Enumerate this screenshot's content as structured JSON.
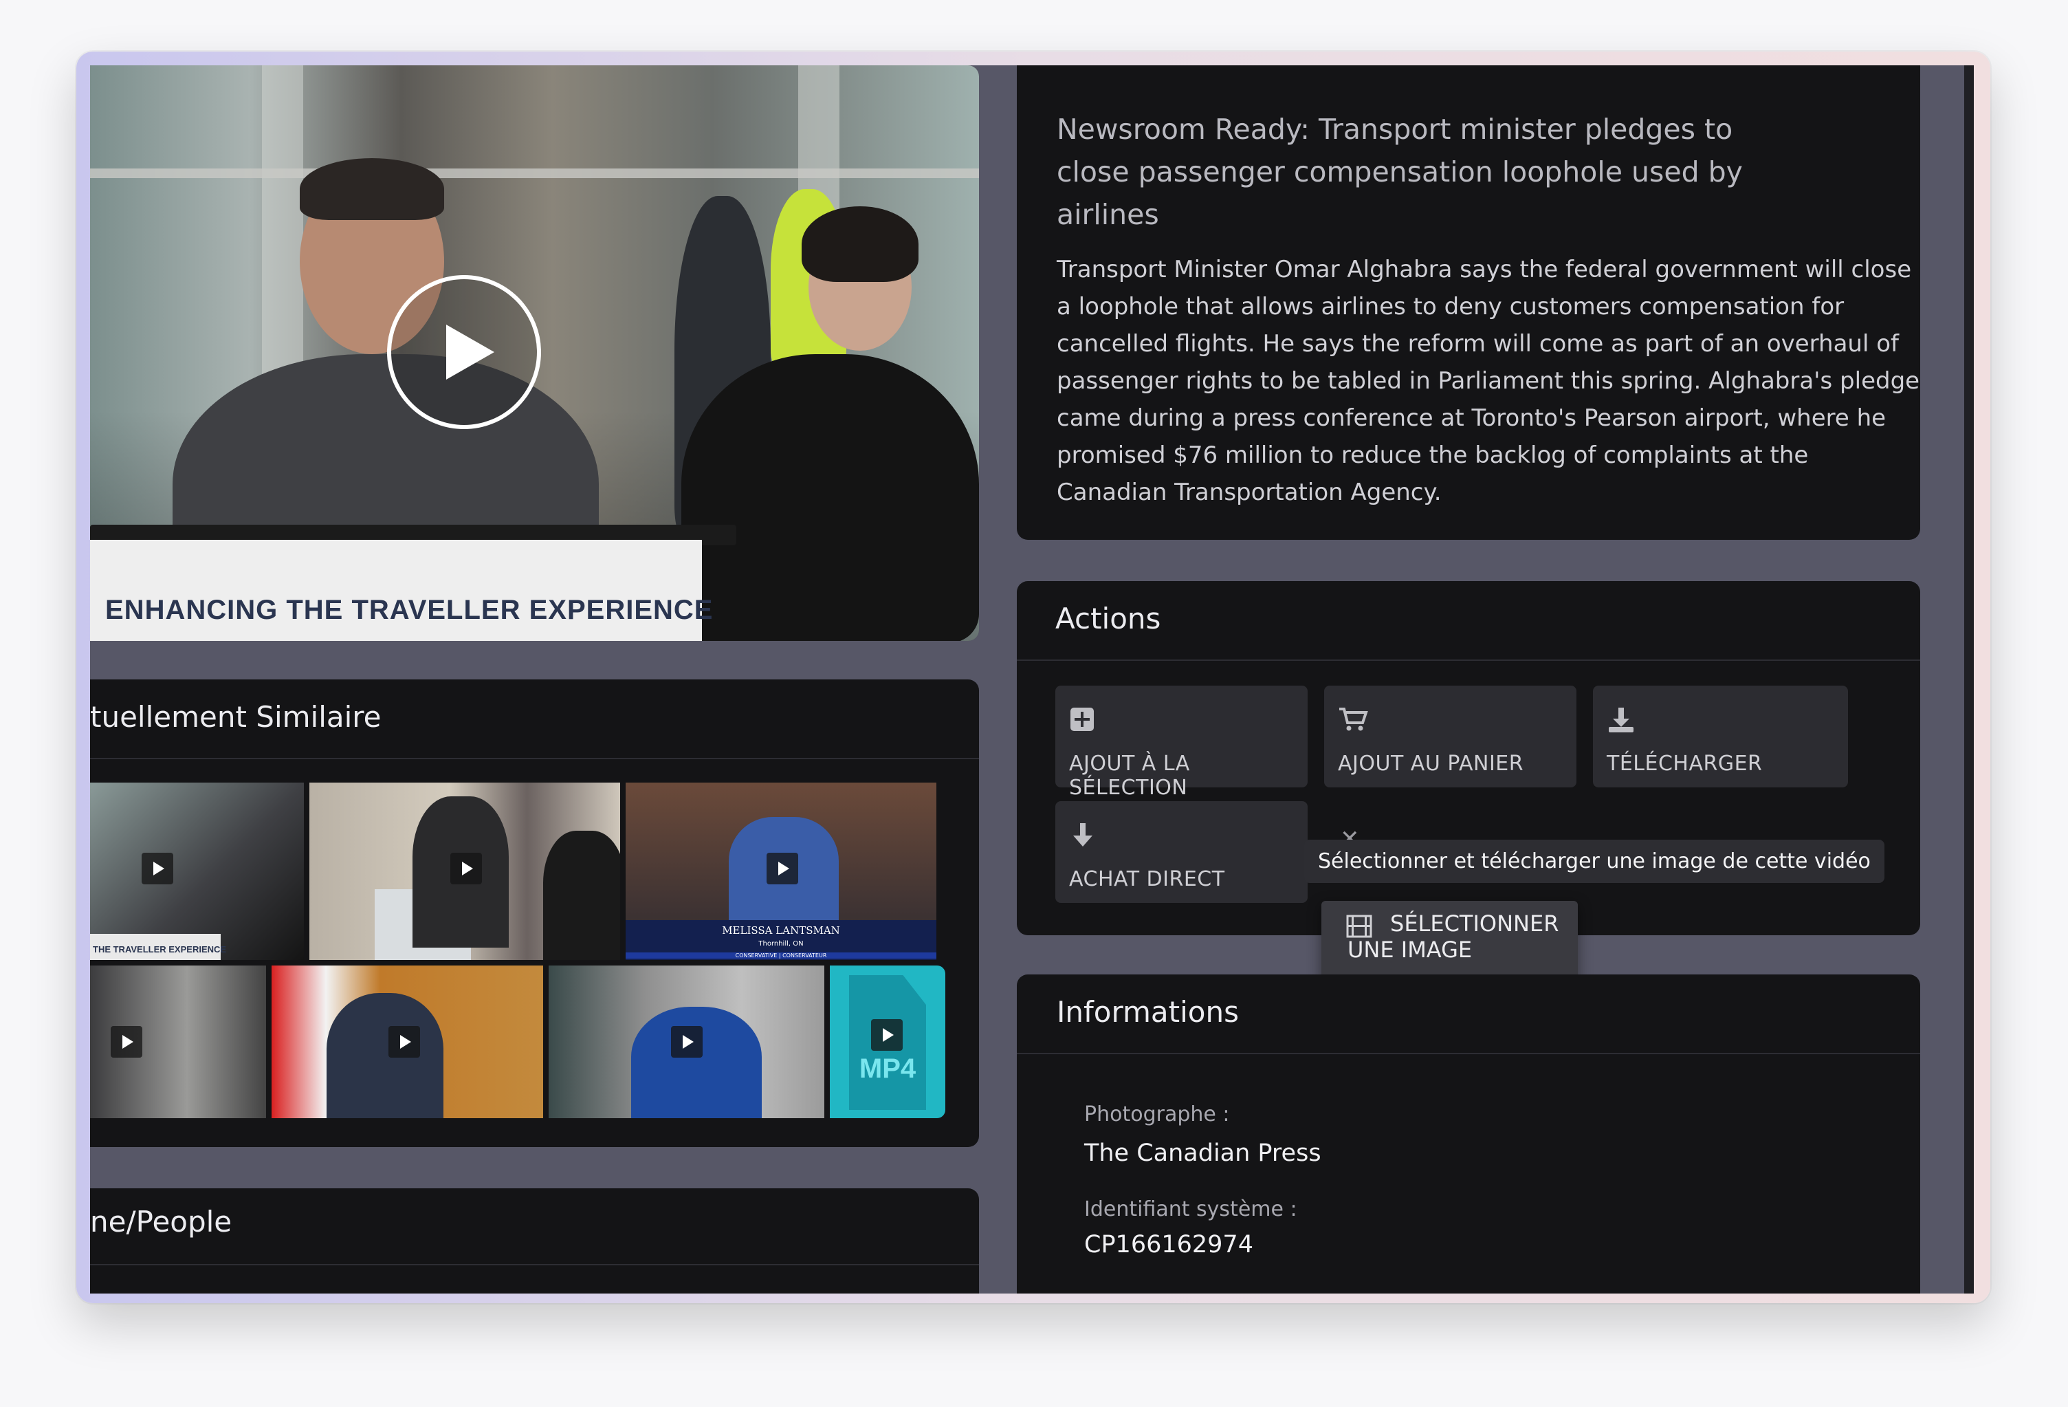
{
  "video": {
    "banner_text": "ENHANCING THE TRAVELLER EXPERIENCE"
  },
  "similar": {
    "title": "tuellement Similaire",
    "thumbnails": [
      {
        "caption": "THE TRAVELLER EXPERIENCE"
      },
      {
        "caption": ""
      },
      {
        "caption": "MELISSA LANTSMAN",
        "subcaption": "Thornhill, ON",
        "party": "CONSERVATIVE | CONSERVATEUR"
      },
      {
        "caption": ""
      },
      {
        "caption": ""
      },
      {
        "caption": ""
      },
      {
        "caption": "MP4"
      }
    ]
  },
  "people": {
    "title": "ne/People"
  },
  "description": {
    "title": "Newsroom Ready: Transport minister pledges to close passenger compensation loophole used by airlines",
    "body": "Transport Minister Omar Alghabra says the federal government will close a loophole that allows airlines to deny customers compensation for cancelled flights. He says the reform will come as part of an overhaul of passenger rights to be tabled in Parliament this spring. Alghabra's pledge came during a press conference at Toronto's Pearson airport, where he promised $76 million to reduce the backlog of complaints at the Canadian Transportation Agency."
  },
  "actions": {
    "title": "Actions",
    "buttons": [
      {
        "label": "AJOUT À LA SÉLECTION",
        "icon": "plus-square-icon"
      },
      {
        "label": "AJOUT AU PANIER",
        "icon": "cart-add-icon"
      },
      {
        "label": "TÉLÉCHARGER",
        "icon": "download-icon"
      },
      {
        "label": "ACHAT DIRECT",
        "icon": "arrow-down-icon"
      }
    ],
    "tooltip": "Sélectionner et télécharger une image de cette vidéo",
    "dropdown_item": "SÉLECTIONNER UNE IMAGE",
    "dropdown_item_line1": "SÉLECTIONNER",
    "dropdown_item_line2": "UNE IMAGE"
  },
  "informations": {
    "title": "Informations",
    "photographer_label": "Photographe :",
    "photographer_value": "The Canadian Press",
    "system_id_label": "Identifiant système :",
    "system_id_value": "CP166162974"
  },
  "colors": {
    "panel_bg": "#141416",
    "app_bg": "#575767",
    "mp4_tile": "#21b7c4"
  }
}
